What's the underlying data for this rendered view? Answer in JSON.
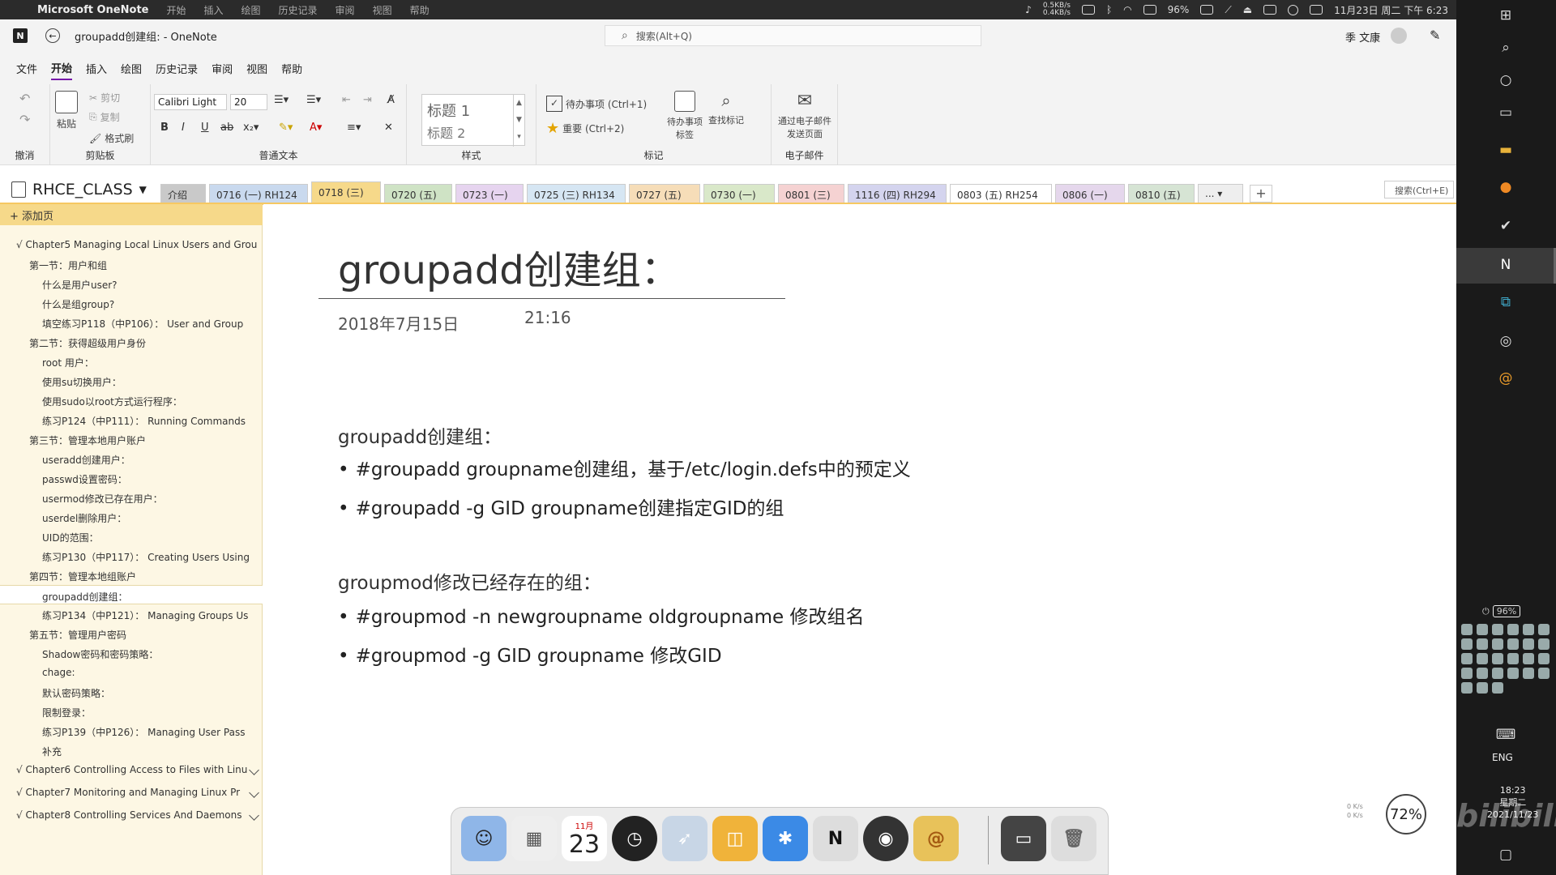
{
  "mac_menu": {
    "app_name": "Microsoft OneNote",
    "items": [
      "开始",
      "插入",
      "绘图",
      "历史记录",
      "审阅",
      "视图",
      "帮助"
    ],
    "net_up": "0.5KB/s",
    "net_down": "0.4KB/s",
    "battery": "96%",
    "datetime": "11月23日 周二 下午 6:23"
  },
  "titlebar": {
    "doc_title": "groupadd创建组:  - OneNote",
    "search_placeholder": "搜索(Alt+Q)",
    "user_name": "季 文康"
  },
  "ribbon_tabs": [
    "文件",
    "开始",
    "插入",
    "绘图",
    "历史记录",
    "审阅",
    "视图",
    "帮助"
  ],
  "ribbon": {
    "undo_label": "撤消",
    "paste_label": "粘贴",
    "cut_label": "剪切",
    "copy_label": "复制",
    "format_painter_label": "格式刷",
    "clipboard_label": "剪贴板",
    "font_name": "Calibri Light",
    "font_size": "20",
    "basic_text_label": "普通文本",
    "style_h1": "标题 1",
    "style_h2": "标题 2",
    "styles_label": "样式",
    "todo_label": "待办事项 (Ctrl+1)",
    "important_label": "重要 (Ctrl+2)",
    "todo_tag_label": "待办事项标签",
    "find_tags_label": "查找标记",
    "tags_label": "标记",
    "email_page_label": "通过电子邮件发送页面",
    "email_label": "电子邮件"
  },
  "notebook": {
    "name": "RHCE_CLASS",
    "sections": [
      {
        "label": "介绍",
        "color": "#c9c9c9"
      },
      {
        "label": "0716 (一) RH124",
        "color": "#c9d9ee"
      },
      {
        "label": "0718 (三)",
        "color": "#f6d98a"
      },
      {
        "label": "0720 (五)",
        "color": "#cfe3c5"
      },
      {
        "label": "0723 (一)",
        "color": "#e6d4ef"
      },
      {
        "label": "0725 (三) RH134",
        "color": "#d6e6f3"
      },
      {
        "label": "0727 (五)",
        "color": "#f6ddb8"
      },
      {
        "label": "0730 (一)",
        "color": "#d9e8c9"
      },
      {
        "label": "0801 (三)",
        "color": "#f5d2d2"
      },
      {
        "label": "1116 (四) RH294",
        "color": "#d4d4ee"
      },
      {
        "label": "0803 (五) RH254",
        "color": "#ffffff"
      },
      {
        "label": "0806 (一)",
        "color": "#e5d7ec"
      },
      {
        "label": "0810 (五)",
        "color": "#d6e4d4"
      },
      {
        "label": "... ▾",
        "color": "#eeeeee"
      }
    ],
    "add_tab": "+",
    "search_label": "搜索(Ctrl+E)"
  },
  "pagelist": {
    "add_page": "+ 添加页",
    "pages": [
      {
        "label": "√ Chapter5 Managing Local Linux Users and Grou",
        "level": 0
      },
      {
        "label": "第一节：用户和组",
        "level": 1
      },
      {
        "label": "什么是用户user?",
        "level": 2
      },
      {
        "label": "什么是组group?",
        "level": 2
      },
      {
        "label": "填空练习P118（中P106）：  User and Group",
        "level": 2
      },
      {
        "label": "第二节：获得超级用户身份",
        "level": 1
      },
      {
        "label": "root 用户：",
        "level": 2
      },
      {
        "label": "使用su切换用户：",
        "level": 2
      },
      {
        "label": "使用sudo以root方式运行程序：",
        "level": 2
      },
      {
        "label": "练习P124（中P111）：  Running Commands",
        "level": 2
      },
      {
        "label": "第三节：管理本地用户账户",
        "level": 1
      },
      {
        "label": "useradd创建用户：",
        "level": 2
      },
      {
        "label": "passwd设置密码：",
        "level": 2
      },
      {
        "label": "usermod修改已存在用户：",
        "level": 2
      },
      {
        "label": "userdel删除用户：",
        "level": 2
      },
      {
        "label": "UID的范围：",
        "level": 2
      },
      {
        "label": "练习P130（中P117）：  Creating Users Using",
        "level": 2
      },
      {
        "label": "第四节：管理本地组账户",
        "level": 1
      },
      {
        "label": "groupadd创建组：",
        "level": 2,
        "selected": true
      },
      {
        "label": "练习P134（中P121）：  Managing Groups Us",
        "level": 2
      },
      {
        "label": "第五节：管理用户密码",
        "level": 1
      },
      {
        "label": "Shadow密码和密码策略：",
        "level": 2
      },
      {
        "label": "chage:",
        "level": 2
      },
      {
        "label": "默认密码策略：",
        "level": 2
      },
      {
        "label": "限制登录：",
        "level": 2
      },
      {
        "label": "练习P139（中P126）：  Managing User Pass",
        "level": 2
      },
      {
        "label": "补充",
        "level": 2
      }
    ],
    "chapters": [
      "√ Chapter6 Controlling Access to Files with Linu",
      "√ Chapter7 Monitoring and Managing Linux Pr",
      "√ Chapter8 Controlling Services And Daemons"
    ]
  },
  "page": {
    "title": "groupadd创建组：",
    "date": "2018年7月15日",
    "time": "21:16",
    "heading1": "groupadd创建组：",
    "bullets1": [
      "#groupadd groupname创建组，基于/etc/login.defs中的预定义",
      "#groupadd -g GID groupname创建指定GID的组"
    ],
    "heading2": "groupmod修改已经存在的组：",
    "bullets2": [
      "#groupmod -n newgroupname oldgroupname 修改组名",
      "#groupmod -g GID groupname 修改GID"
    ]
  },
  "dock": {
    "calendar_month": "11月",
    "calendar_day": "23",
    "onenote_letter": "N"
  },
  "zoom_level": "72%",
  "speed": {
    "up": "0 K/s",
    "down": "0 K/s"
  },
  "sidebar": {
    "battery": "96%",
    "lang": "ENG",
    "clock_time": "18:23",
    "clock_day": "星期二",
    "clock_date": "2021/11/23",
    "watermark": "bilibili"
  }
}
